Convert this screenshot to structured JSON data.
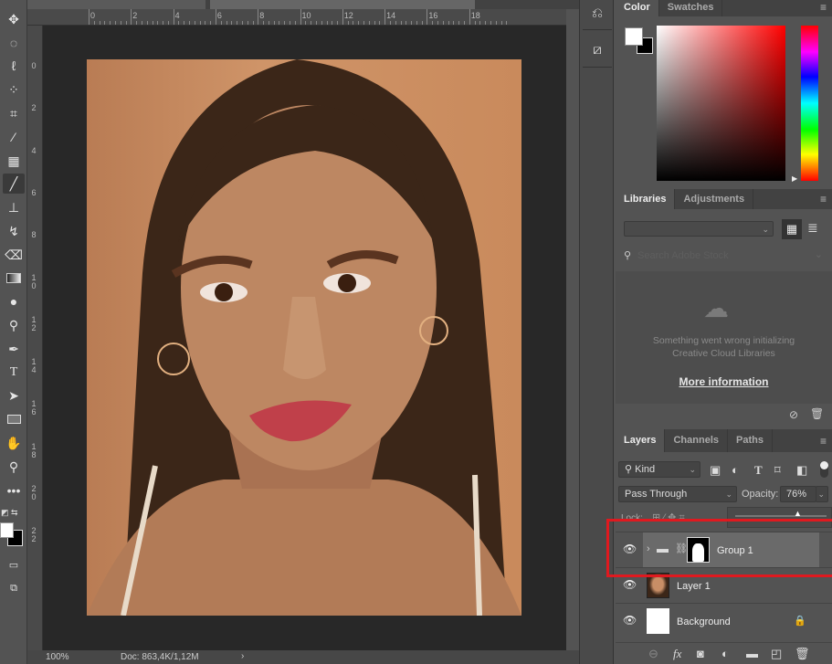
{
  "toolbar": {
    "tools": [
      "move",
      "rectangular-marquee",
      "lasso",
      "quick-selection",
      "crop",
      "eyedropper",
      "healing-brush",
      "brush",
      "clone-stamp",
      "history-brush",
      "eraser",
      "gradient",
      "blur",
      "dodge",
      "pen",
      "type",
      "path-selection",
      "rectangle",
      "hand",
      "zoom",
      "edit-toolbar",
      "default-colors",
      "foreground-background",
      "quick-mask",
      "screen-mode"
    ],
    "active": "brush"
  },
  "ruler": {
    "h_labels": [
      "0",
      "2",
      "4",
      "6",
      "8",
      "10",
      "12",
      "14",
      "16",
      "18"
    ],
    "v_labels": [
      "0",
      "2",
      "4",
      "6",
      "8",
      "10",
      "12",
      "14",
      "16",
      "18",
      "20",
      "22"
    ]
  },
  "status": {
    "zoom": "100%",
    "doc": "Doc: 863,4K/1,12M",
    "arrow": "›"
  },
  "color_panel": {
    "tabs": [
      "Color",
      "Swatches"
    ],
    "active": "Color",
    "foreground": "#ffffff",
    "background": "#000000",
    "hue": "#ff0000"
  },
  "libraries_panel": {
    "tabs": [
      "Libraries",
      "Adjustments"
    ],
    "active": "Libraries",
    "search_placeholder": "Search Adobe Stock",
    "error_line1": "Something went wrong initializing",
    "error_line2": "Creative Cloud Libraries",
    "more_info": "More information"
  },
  "layers_panel": {
    "tabs": [
      "Layers",
      "Channels",
      "Paths"
    ],
    "active": "Layers",
    "filter": "Kind",
    "blend_mode": "Pass Through",
    "opacity_label": "Opacity:",
    "opacity": "76%",
    "opacity_value": 76,
    "lock_label": "Lock:",
    "layers": [
      {
        "name": "Group 1",
        "type": "group",
        "visible": true,
        "selected": true
      },
      {
        "name": "Layer 1",
        "type": "pixel",
        "visible": true
      },
      {
        "name": "Background",
        "type": "background",
        "visible": true,
        "locked": true
      }
    ]
  },
  "highlight_color": "#e0191f"
}
